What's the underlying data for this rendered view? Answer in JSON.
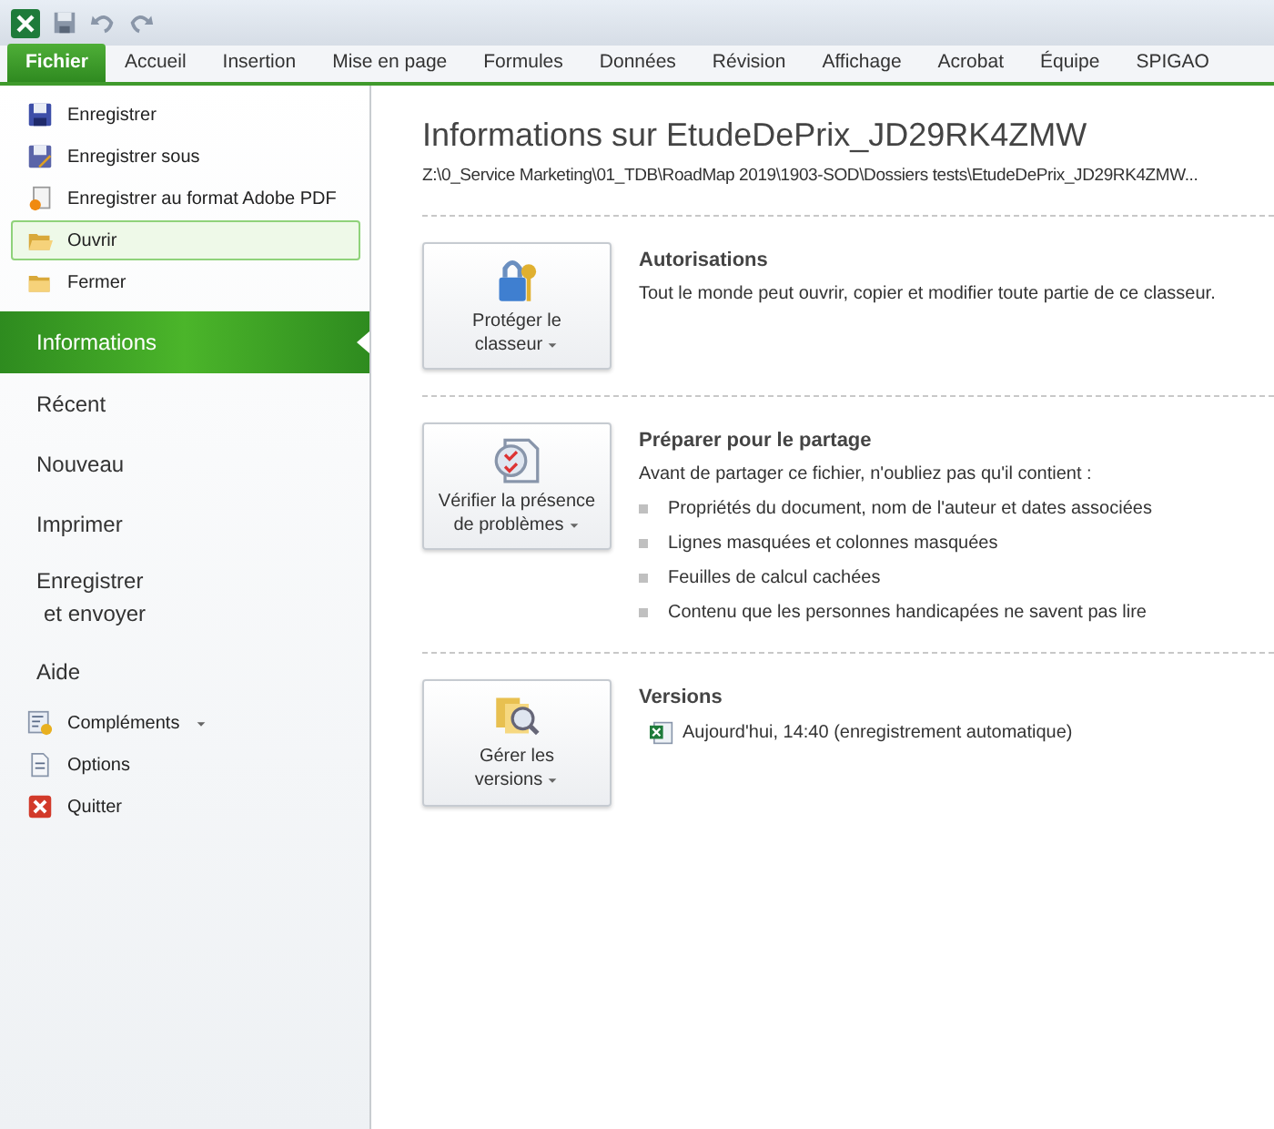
{
  "tabs": [
    {
      "label": "Fichier",
      "selected": true
    },
    {
      "label": "Accueil",
      "selected": false
    },
    {
      "label": "Insertion",
      "selected": false
    },
    {
      "label": "Mise en page",
      "selected": false
    },
    {
      "label": "Formules",
      "selected": false
    },
    {
      "label": "Données",
      "selected": false
    },
    {
      "label": "Révision",
      "selected": false
    },
    {
      "label": "Affichage",
      "selected": false
    },
    {
      "label": "Acrobat",
      "selected": false
    },
    {
      "label": "Équipe",
      "selected": false
    },
    {
      "label": "SPIGAO",
      "selected": false
    }
  ],
  "sidebar": {
    "items": [
      {
        "kind": "save",
        "lines": [
          "Enregistrer"
        ],
        "selected": false,
        "highlighted": false
      },
      {
        "kind": "saveas",
        "lines": [
          "Enregistrer sous"
        ],
        "selected": false,
        "highlighted": false
      },
      {
        "kind": "pdf",
        "lines": [
          "Enregistrer au format Adobe PDF"
        ],
        "selected": false,
        "highlighted": false
      },
      {
        "kind": "open",
        "lines": [
          "Ouvrir"
        ],
        "selected": false,
        "highlighted": true
      },
      {
        "kind": "close",
        "lines": [
          "Fermer"
        ],
        "selected": false,
        "highlighted": false
      },
      {
        "kind": "page",
        "lines": [
          "Informations"
        ],
        "selected": true,
        "highlighted": false
      },
      {
        "kind": "page",
        "lines": [
          "Récent"
        ],
        "selected": false,
        "highlighted": false
      },
      {
        "kind": "page",
        "lines": [
          "Nouveau"
        ],
        "selected": false,
        "highlighted": false
      },
      {
        "kind": "page",
        "lines": [
          "Imprimer"
        ],
        "selected": false,
        "highlighted": false
      },
      {
        "kind": "page",
        "lines": [
          "Enregistrer",
          "et envoyer"
        ],
        "selected": false,
        "highlighted": false
      },
      {
        "kind": "page",
        "lines": [
          "Aide"
        ],
        "selected": false,
        "highlighted": false
      },
      {
        "kind": "addins",
        "lines": [
          "Compléments"
        ],
        "dropdown": true,
        "selected": false,
        "highlighted": false
      },
      {
        "kind": "options",
        "lines": [
          "Options"
        ],
        "selected": false,
        "highlighted": false
      },
      {
        "kind": "exit",
        "lines": [
          "Quitter"
        ],
        "selected": false,
        "highlighted": false
      }
    ]
  },
  "info": {
    "title": "Informations sur EtudeDePrix_JD29RK4ZMW",
    "path": "Z:\\0_Service Marketing\\01_TDB\\RoadMap 2019\\1903-SOD\\Dossiers tests\\EtudeDePrix_JD29RK4ZMW...",
    "sections": [
      {
        "kind": "lock",
        "button_lines": [
          "Protéger le",
          "classeur"
        ],
        "heading": "Autorisations",
        "text": "Tout le monde peut ouvrir, copier et modifier toute partie de ce classeur."
      },
      {
        "kind": "inspect",
        "button_lines": [
          "Vérifier la présence",
          "de problèmes"
        ],
        "heading": "Préparer pour le partage",
        "text": "Avant de partager ce fichier, n'oubliez pas qu'il contient :",
        "bullets": [
          "Propriétés du document, nom de l'auteur et dates associées",
          "Lignes masquées et colonnes masquées",
          "Feuilles de calcul cachées",
          "Contenu que les personnes handicapées ne savent pas lire"
        ]
      },
      {
        "kind": "versions",
        "button_lines": [
          "Gérer les",
          "versions"
        ],
        "heading": "Versions",
        "versions": [
          "Aujourd'hui, 14:40 (enregistrement automatique)"
        ]
      }
    ]
  }
}
